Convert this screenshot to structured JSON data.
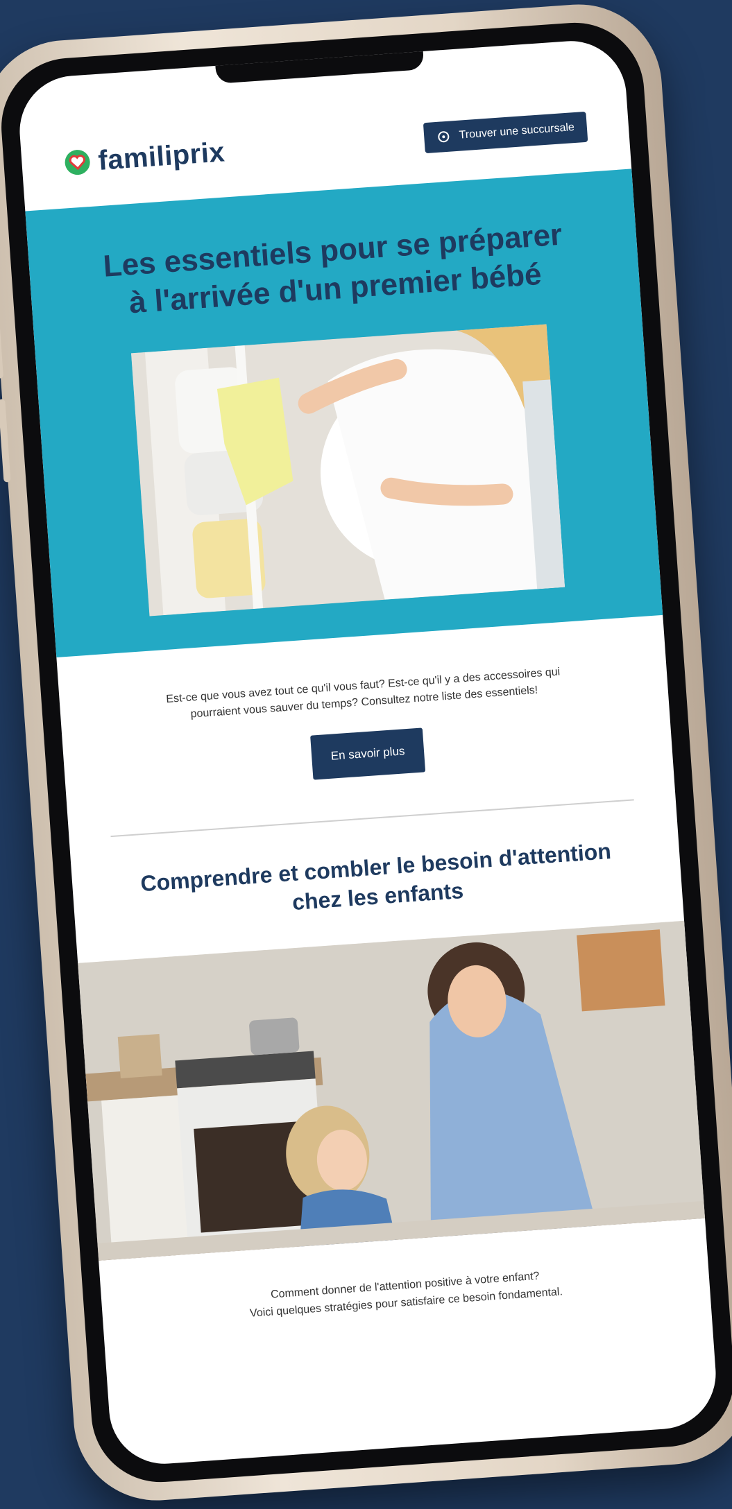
{
  "brand": {
    "name": "familiprix",
    "colors": {
      "navy": "#1e3a5f",
      "teal": "#23a9c4",
      "logo_green": "#2eb060",
      "logo_red": "#e23a3a"
    }
  },
  "header": {
    "find_store_label": "Trouver une succursale",
    "find_store_icon": "location-target-icon"
  },
  "hero": {
    "title_line1": "Les essentiels pour se préparer",
    "title_line2": "à l'arrivée d'un premier bébé"
  },
  "article1": {
    "text_line1": "Est-ce que vous avez tout ce qu'il vous faut? Est-ce qu'il y a des accessoires qui",
    "text_line2": "pourraient vous sauver du temps? Consultez notre liste des essentiels!",
    "cta_label": "En savoir plus"
  },
  "article2": {
    "title_line1": "Comprendre et combler le besoin d'attention",
    "title_line2": "chez les enfants",
    "text_line1": "Comment donner de l'attention positive à votre enfant?",
    "text_line2": "Voici quelques stratégies pour satisfaire ce besoin fondamental."
  }
}
